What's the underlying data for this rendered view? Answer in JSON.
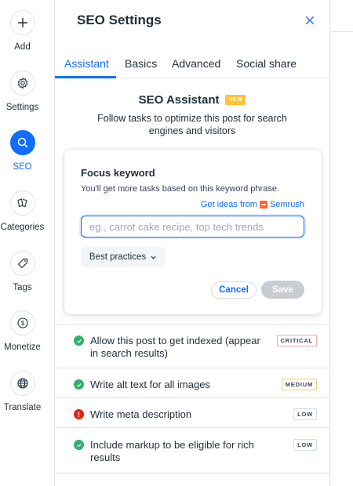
{
  "sidebar": {
    "items": [
      {
        "label": "Add",
        "icon": "plus-icon"
      },
      {
        "label": "Settings",
        "icon": "gear-icon"
      },
      {
        "label": "SEO",
        "icon": "search-icon",
        "active": true
      },
      {
        "label": "Categories",
        "icon": "categories-icon"
      },
      {
        "label": "Tags",
        "icon": "tag-icon"
      },
      {
        "label": "Monetize",
        "icon": "dollar-icon"
      },
      {
        "label": "Translate",
        "icon": "globe-icon"
      }
    ]
  },
  "panel": {
    "title": "SEO Settings",
    "tabs": [
      {
        "label": "Assistant",
        "active": true
      },
      {
        "label": "Basics"
      },
      {
        "label": "Advanced"
      },
      {
        "label": "Social share"
      }
    ]
  },
  "assistant": {
    "title": "SEO Assistant",
    "badge": "NEW",
    "subtitle": "Follow tasks to optimize this post for search engines and visitors"
  },
  "focus_keyword": {
    "title": "Focus keyword",
    "description": "You'll get more tasks based on this keyword phrase.",
    "ideas_link": "Get ideas from",
    "ideas_brand": "Semrush",
    "input_value": "",
    "input_placeholder": "eg., carrot cake recipe, top tech trends",
    "best_practices": "Best practices",
    "cancel": "Cancel",
    "save": "Save"
  },
  "tasks": [
    {
      "text": "Allow this post to get indexed (appear in search results)",
      "status": "done",
      "priority": "CRITICAL"
    },
    {
      "text": "Write alt text for all images",
      "status": "done",
      "priority": "MEDIUM"
    },
    {
      "text": "Write meta description",
      "status": "error",
      "priority": "LOW"
    },
    {
      "text": "Include markup to be eligible for rich results",
      "status": "done",
      "priority": "LOW"
    }
  ],
  "colors": {
    "accent": "#116dff",
    "success": "#2fb26a",
    "error": "#e62214",
    "new_badge": "#ffc233"
  }
}
